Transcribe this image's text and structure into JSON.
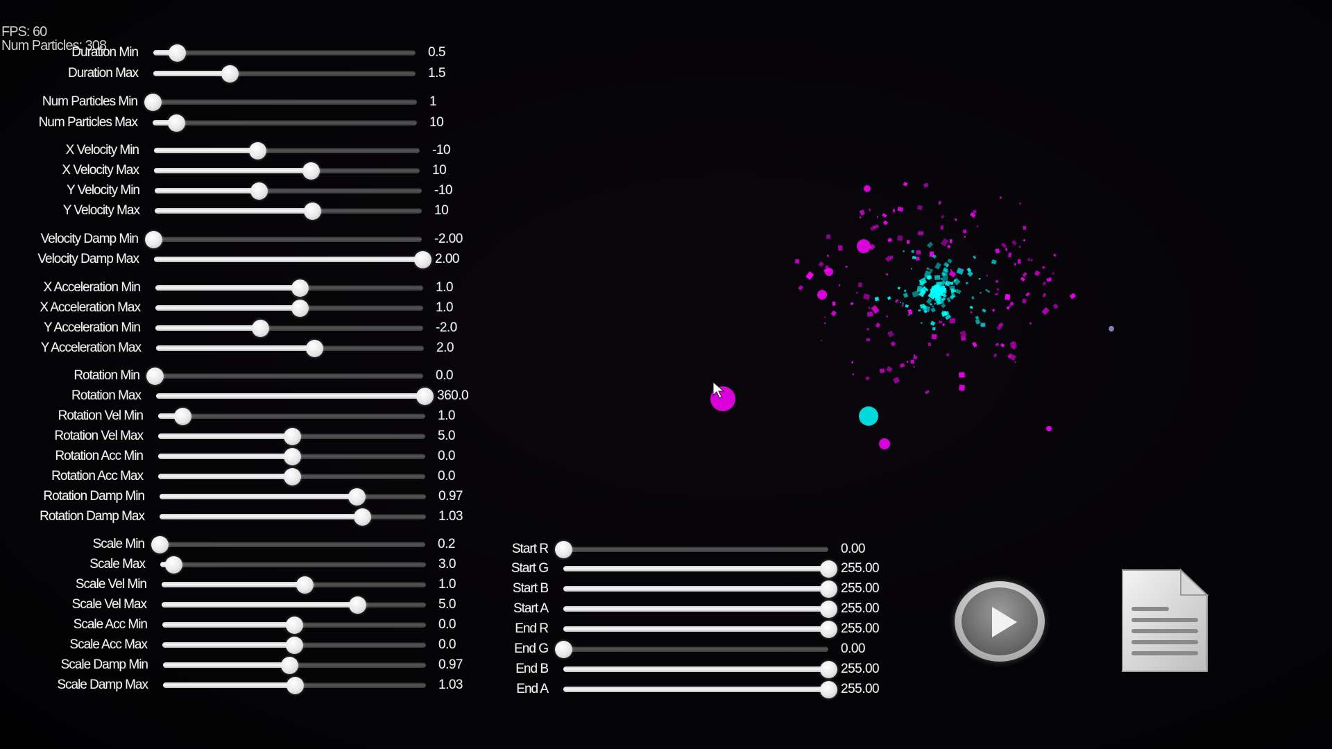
{
  "stats": {
    "fps": "FPS: 60",
    "num_particles": "Num Particles: 308"
  },
  "left_sliders": [
    {
      "label": "Duration Min",
      "value": "0.5",
      "fraction": 0.09
    },
    {
      "label": "Duration Max",
      "value": "1.5",
      "fraction": 0.29
    },
    {
      "label": "Num Particles Min",
      "value": "1",
      "fraction": 0.0
    },
    {
      "label": "Num Particles Max",
      "value": "10",
      "fraction": 0.09
    },
    {
      "label": "X Velocity Min",
      "value": "-10",
      "fraction": 0.39
    },
    {
      "label": "X Velocity Max",
      "value": "10",
      "fraction": 0.59
    },
    {
      "label": "Y Velocity Min",
      "value": "-10",
      "fraction": 0.39
    },
    {
      "label": "Y Velocity Max",
      "value": "10",
      "fraction": 0.59
    },
    {
      "label": "Velocity Damp Min",
      "value": "-2.00",
      "fraction": 0.0
    },
    {
      "label": "Velocity Damp Max",
      "value": "2.00",
      "fraction": 1.0
    },
    {
      "label": "X Acceleration Min",
      "value": "1.0",
      "fraction": 0.54
    },
    {
      "label": "X Acceleration Max",
      "value": "1.0",
      "fraction": 0.54
    },
    {
      "label": "Y Acceleration Min",
      "value": "-2.0",
      "fraction": 0.39
    },
    {
      "label": "Y Acceleration Max",
      "value": "2.0",
      "fraction": 0.59
    },
    {
      "label": "Rotation Min",
      "value": "0.0",
      "fraction": 0.0
    },
    {
      "label": "Rotation Max",
      "value": "360.0",
      "fraction": 1.0
    },
    {
      "label": "Rotation Vel Min",
      "value": "1.0",
      "fraction": 0.09
    },
    {
      "label": "Rotation Vel Max",
      "value": "5.0",
      "fraction": 0.5
    },
    {
      "label": "Rotation Acc Min",
      "value": "0.0",
      "fraction": 0.5
    },
    {
      "label": "Rotation Acc Max",
      "value": "0.0",
      "fraction": 0.5
    },
    {
      "label": "Rotation Damp Min",
      "value": "0.97",
      "fraction": 0.74
    },
    {
      "label": "Rotation Damp Max",
      "value": "1.03",
      "fraction": 0.76
    },
    {
      "label": "Scale Min",
      "value": "0.2",
      "fraction": 0.0
    },
    {
      "label": "Scale Max",
      "value": "3.0",
      "fraction": 0.05
    },
    {
      "label": "Scale Vel Min",
      "value": "1.0",
      "fraction": 0.54
    },
    {
      "label": "Scale Vel Max",
      "value": "5.0",
      "fraction": 0.74
    },
    {
      "label": "Scale Acc Min",
      "value": "0.0",
      "fraction": 0.5
    },
    {
      "label": "Scale Acc Max",
      "value": "0.0",
      "fraction": 0.5
    },
    {
      "label": "Scale Damp Min",
      "value": "0.97",
      "fraction": 0.48
    },
    {
      "label": "Scale Damp Max",
      "value": "1.03",
      "fraction": 0.5
    }
  ],
  "color_sliders": [
    {
      "label": "Start R",
      "value": "0.00",
      "fraction": 0.0
    },
    {
      "label": "Start G",
      "value": "255.00",
      "fraction": 1.0
    },
    {
      "label": "Start B",
      "value": "255.00",
      "fraction": 1.0
    },
    {
      "label": "Start A",
      "value": "255.00",
      "fraction": 1.0
    },
    {
      "label": "End R",
      "value": "255.00",
      "fraction": 1.0
    },
    {
      "label": "End G",
      "value": "0.00",
      "fraction": 0.0
    },
    {
      "label": "End B",
      "value": "255.00",
      "fraction": 1.0
    },
    {
      "label": "End A",
      "value": "255.00",
      "fraction": 1.0
    }
  ],
  "icons": {
    "play": "play-icon",
    "file": "document-icon",
    "cursor": "mouse-cursor-icon"
  },
  "colors": {
    "start_color": "#00ffff",
    "end_color": "#ff00ff",
    "background": "#050407"
  }
}
